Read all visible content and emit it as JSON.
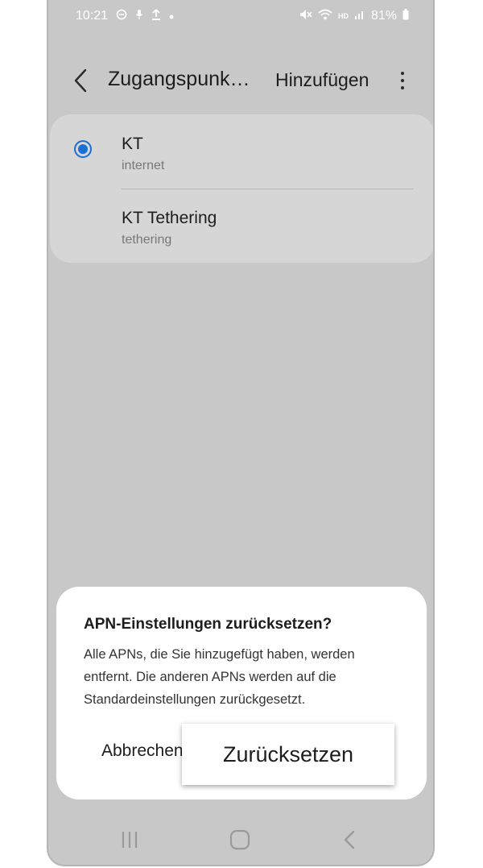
{
  "status_bar": {
    "time": "10:21",
    "battery": "81%",
    "left_icons": [
      "dnd-icon",
      "mic-icon",
      "upload-icon",
      "dot-icon"
    ],
    "right_icons": [
      "mute-icon",
      "wifi-icon",
      "hd-voice-icon",
      "signal-icon",
      "battery-icon"
    ],
    "hd_label": "HD"
  },
  "app_bar": {
    "title": "Zugangspunk…",
    "add_label": "Hinzufügen"
  },
  "apn_list": [
    {
      "name": "KT",
      "apn": "internet",
      "selected": true
    },
    {
      "name": "KT Tethering",
      "apn": "tethering",
      "selected": false
    }
  ],
  "dialog": {
    "title": "APN-Einstellungen zurücksetzen?",
    "message": "Alle APNs, die Sie hinzugefügt haben, werden entfernt. Die anderen APNs werden auf die Standardeinstellungen zurückgesetzt.",
    "cancel_label": "Abbrechen",
    "confirm_label": "Zurücksetzen"
  },
  "nav_bar": [
    "recents-icon",
    "home-icon",
    "back-icon"
  ],
  "colors": {
    "accent": "#1a6fd4",
    "dim_background": "#c8c8c8",
    "card": "#d6d6d6",
    "dialog": "#ffffff"
  }
}
